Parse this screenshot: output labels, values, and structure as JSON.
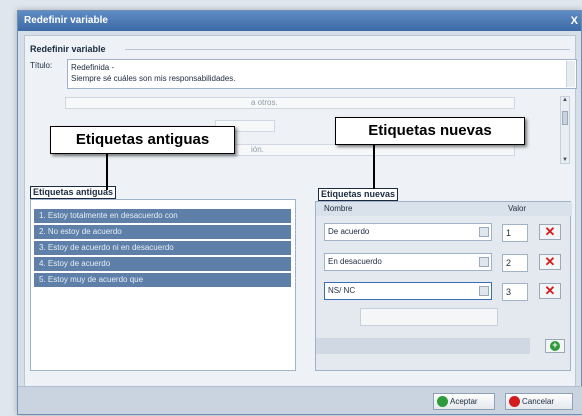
{
  "window": {
    "title": "Redefinir variable",
    "close": "X"
  },
  "form": {
    "section_title": "Redefinir variable",
    "titulo_label": "Título:",
    "titulo_line1": "Redefinida -",
    "titulo_line2": "Siempre sé cuáles son mis responsabilidades.",
    "ghost_text_1": "a otros.",
    "ghost_text_2": "ión."
  },
  "callouts": {
    "old": "Etiquetas antiguas",
    "new": "Etiquetas nuevas"
  },
  "old_labels": {
    "title": "Etiquetas antiguas",
    "items": [
      "1. Estoy totalmente en desacuerdo con",
      "2. No estoy de acuerdo",
      "3. Estoy de acuerdo ni en desacuerdo",
      "4. Estoy de acuerdo",
      "5. Estoy muy de acuerdo que"
    ]
  },
  "new_labels": {
    "title": "Etiquetas nuevas",
    "col_name": "Nombre",
    "col_value": "Valor",
    "rows": [
      {
        "name": "De acuerdo",
        "value": "1"
      },
      {
        "name": "En desacuerdo",
        "value": "2"
      },
      {
        "name": "NS/ NC",
        "value": "3"
      }
    ]
  },
  "buttons": {
    "accept": "Aceptar",
    "cancel": "Cancelar"
  },
  "colors": {
    "accent": "#3d6aa5",
    "item_bg": "#5d7fa8",
    "delete": "#d31c1c",
    "add": "#2e9b3a"
  }
}
